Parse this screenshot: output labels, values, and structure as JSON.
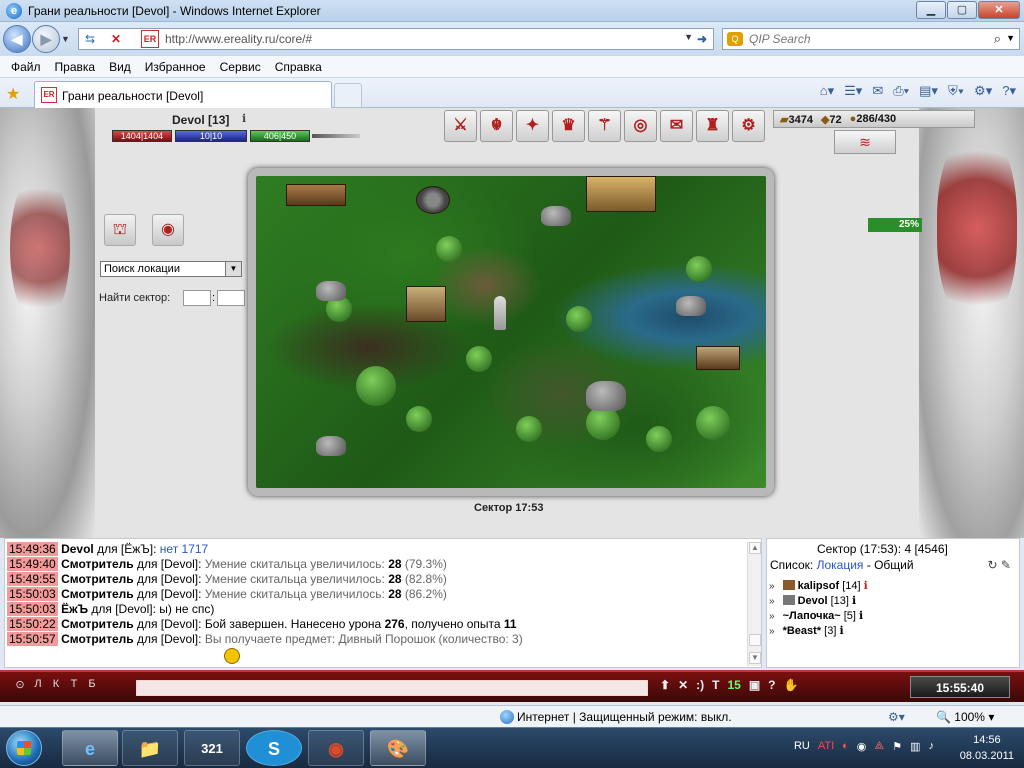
{
  "window": {
    "title": "Грани реальности [Devol] - Windows Internet Explorer",
    "min_icon": "minimize-icon",
    "max_icon": "maximize-icon",
    "close_icon": "close-icon"
  },
  "address": {
    "url": "http://www.ereality.ru/core/#",
    "search_placeholder": "QIP Search",
    "favicon_text": "ER"
  },
  "menu": [
    "Файл",
    "Правка",
    "Вид",
    "Избранное",
    "Сервис",
    "Справка"
  ],
  "tab": {
    "label": "Грани реальности [Devol]"
  },
  "character": {
    "name": "Devol",
    "level": "[13]",
    "hp": "1404|1404",
    "mp": "10|10",
    "energy": "406|450"
  },
  "resources": {
    "r1": "3474",
    "r2": "72",
    "r3": "286/430"
  },
  "top_icons": [
    "⚔",
    "☬",
    "✦",
    "♛",
    "⚚",
    "◎",
    "✉",
    "♜",
    "⚙"
  ],
  "progress": {
    "label": "25%",
    "value": 25
  },
  "side_panel": {
    "select_value": "Поиск локации",
    "find_label": "Найти сектор:",
    "colon": ":"
  },
  "map": {
    "sector_label": "Сектор 17:53"
  },
  "chat": {
    "lines": [
      {
        "time": "15:49:36",
        "who": "Devol",
        "mid": " для [ЁжЪ]: ",
        "msg": "нет 1717",
        "msg_class": "blue"
      },
      {
        "time": "15:49:40",
        "who": "Смотритель",
        "mid": " для [Devol]: ",
        "msg": "Умение скитальца увеличилось: ",
        "num": "28",
        "tail": " (79.3%)",
        "msg_class": "gray"
      },
      {
        "time": "15:49:55",
        "who": "Смотритель",
        "mid": " для [Devol]: ",
        "msg": "Умение скитальца увеличилось: ",
        "num": "28",
        "tail": " (82.8%)",
        "msg_class": "gray"
      },
      {
        "time": "15:50:03",
        "who": "Смотритель",
        "mid": " для [Devol]: ",
        "msg": "Умение скитальца увеличилось: ",
        "num": "28",
        "tail": " (86.2%)",
        "msg_class": "gray"
      },
      {
        "time": "15:50:03",
        "who": "ЁжЪ",
        "mid": " для [Devol]: ",
        "msg": "ы) не спс)",
        "msg_class": ""
      },
      {
        "time": "15:50:22",
        "who": "Смотритель",
        "mid": " для [Devol]: ",
        "msg": "Бой завершен. Нанесено урона ",
        "num": "276",
        "tail": ", получено опыта ",
        "num2": "11",
        "msg_class": ""
      },
      {
        "time": "15:50:57",
        "who": "Смотритель",
        "mid": " для [Devol]: ",
        "msg": "Вы получаете предмет: Дивный Порошок (количество: 3)",
        "msg_class": "gray"
      }
    ]
  },
  "sector_panel": {
    "head": "Сектор (17:53): 4 [4546]",
    "list_label": "Список: ",
    "list_loc": "Локация",
    "list_sep": " - Общий",
    "players": [
      {
        "name": "kalipsof",
        "level": "[14]"
      },
      {
        "name": "Devol",
        "level": "[13]"
      },
      {
        "name": "~Лапочка~",
        "level": "[5]"
      },
      {
        "name": "*Beast*",
        "level": "[3]"
      }
    ]
  },
  "inputbar": {
    "letters": [
      "Л",
      "К",
      "Т",
      "Б"
    ],
    "buttons": [
      "⬆",
      "✕",
      ":)",
      "T",
      "15",
      "▣",
      "?",
      "✋"
    ],
    "clock": "15:55:40"
  },
  "statusbar": {
    "zone": "Интернет | Защищенный режим: выкл.",
    "zoom": "100%"
  },
  "taskbar": {
    "items": [
      "e",
      "📁",
      "321",
      "S",
      "◉",
      "🎨"
    ],
    "lang": "RU",
    "time": "14:56",
    "date": "08.03.2011"
  },
  "colors": {
    "accent": "#b21e1e",
    "timestamp_bg": "#f29a9a",
    "progress": "#2a8f2a"
  }
}
